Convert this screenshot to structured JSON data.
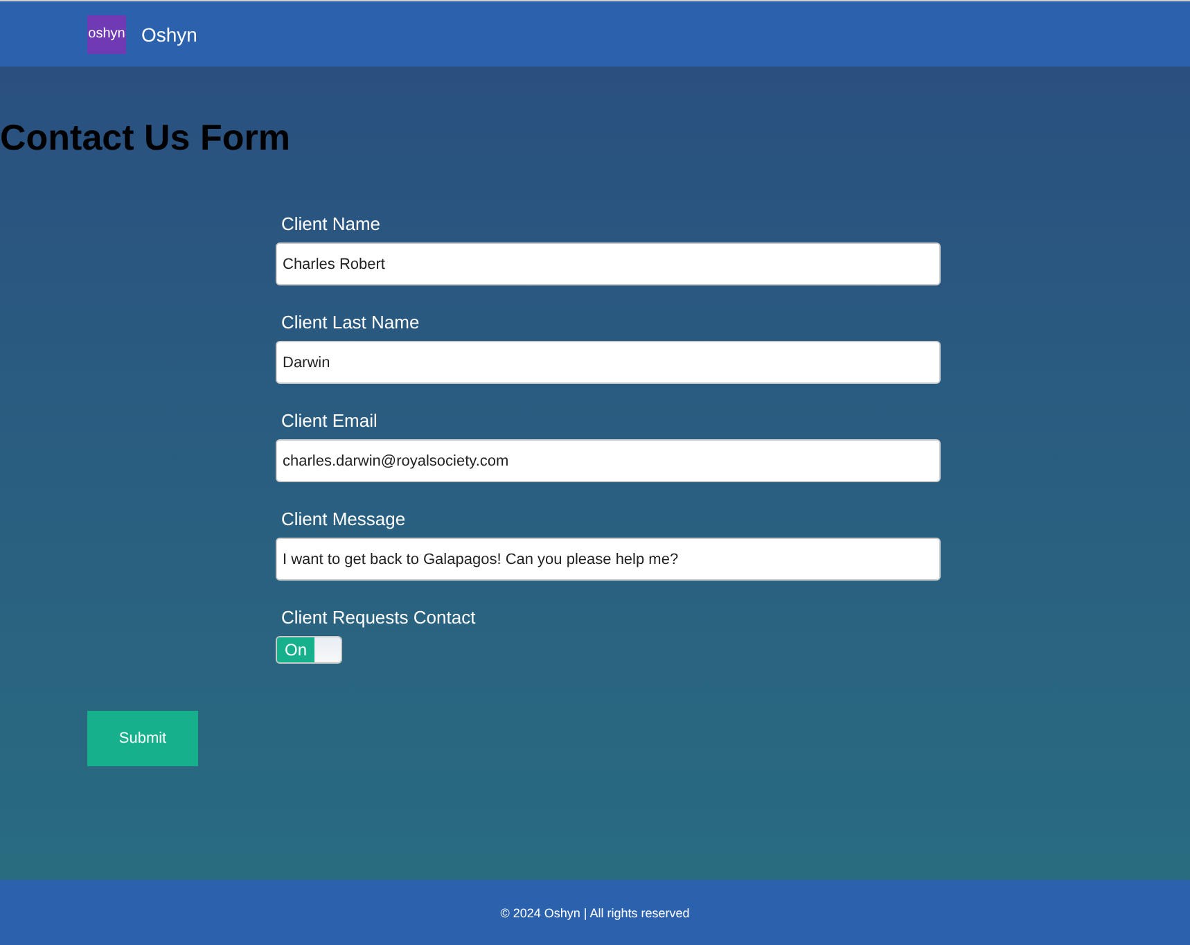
{
  "header": {
    "logo": "oshyn",
    "brand": "Oshyn"
  },
  "title": "Contact Us Form",
  "fields": [
    {
      "label": "Client Name",
      "value": "Charles Robert"
    },
    {
      "label": "Client Last Name",
      "value": "Darwin"
    },
    {
      "label": "Client Email",
      "value": "charles.darwin@royalsociety.com"
    },
    {
      "label": "Client Message",
      "value": "I want to get back to Galapagos! Can you please help me?"
    }
  ],
  "contact_toggle": {
    "label": "Client Requests Contact",
    "state_text": "On",
    "on": true
  },
  "submit": "Submit",
  "footer": "© 2024 Oshyn | All rights reserved"
}
